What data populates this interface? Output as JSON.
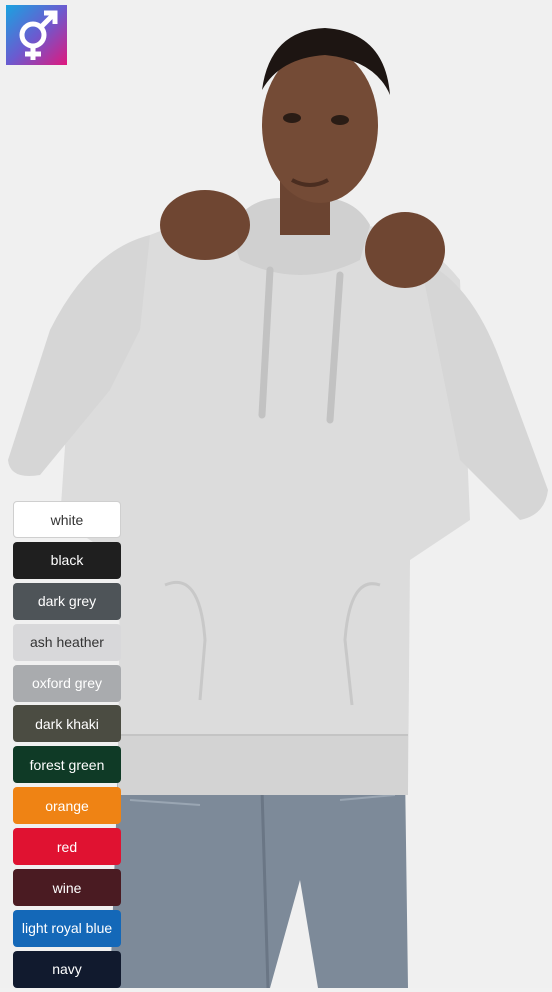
{
  "badge": {
    "icon": "male-female-symbol-icon",
    "gradient": [
      "#1aa3e0",
      "#6a5bd0",
      "#e0187d"
    ]
  },
  "product_photo": {
    "icon": "model-in-hoodie-photo",
    "hoodie_color": "#dedede"
  },
  "colors": [
    {
      "name": "white",
      "hex": "#ffffff",
      "text": "#333333"
    },
    {
      "name": "black",
      "hex": "#1f1f1f",
      "text": "#ffffff"
    },
    {
      "name": "dark grey",
      "hex": "#4e5458",
      "text": "#ffffff"
    },
    {
      "name": "ash heather",
      "hex": "#d8d8da",
      "text": "#333333"
    },
    {
      "name": "oxford grey",
      "hex": "#a9abae",
      "text": "#ffffff"
    },
    {
      "name": "dark khaki",
      "hex": "#4b4c42",
      "text": "#ffffff"
    },
    {
      "name": "forest green",
      "hex": "#0f3a26",
      "text": "#ffffff"
    },
    {
      "name": "orange",
      "hex": "#ef8314",
      "text": "#ffffff"
    },
    {
      "name": "red",
      "hex": "#e01231",
      "text": "#ffffff"
    },
    {
      "name": "wine",
      "hex": "#4a1b22",
      "text": "#ffffff"
    },
    {
      "name": "light royal blue",
      "hex": "#1468b8",
      "text": "#ffffff"
    },
    {
      "name": "navy",
      "hex": "#111a2e",
      "text": "#ffffff"
    }
  ]
}
